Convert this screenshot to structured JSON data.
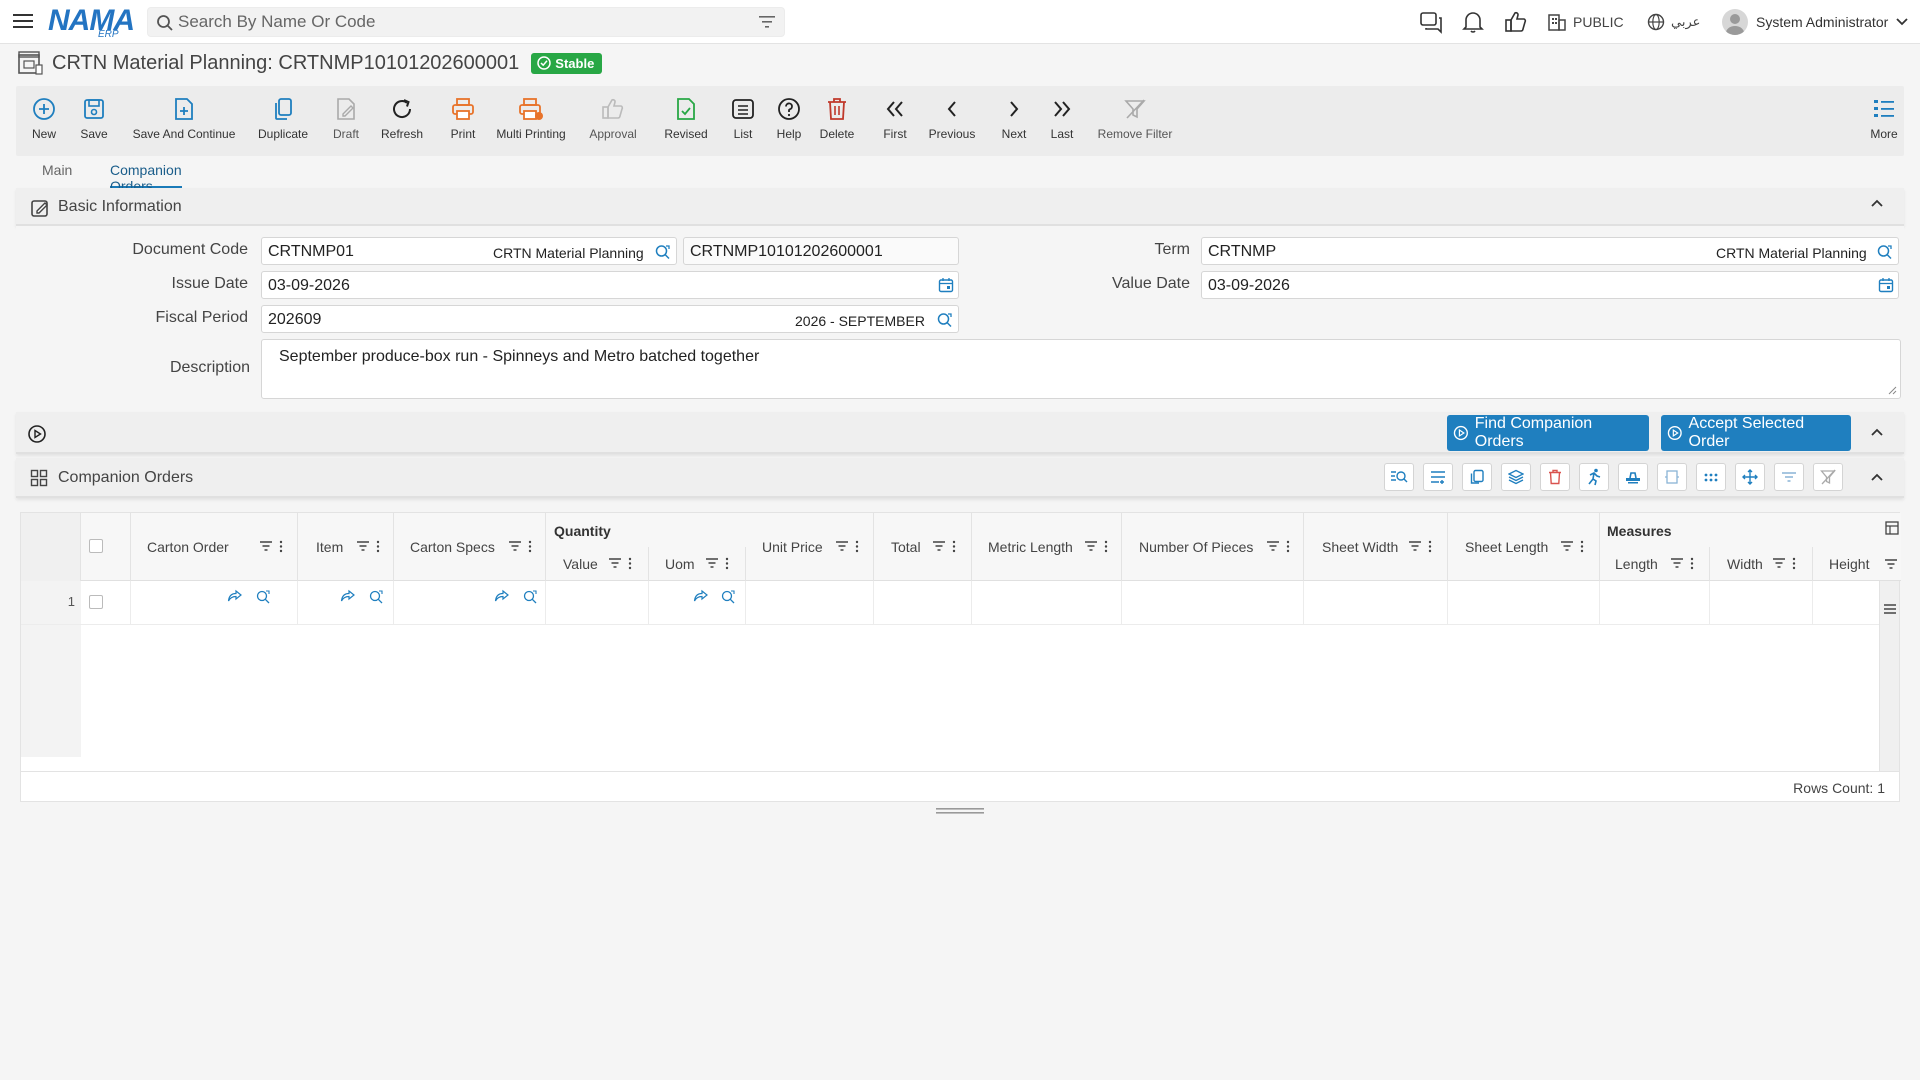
{
  "topbar": {
    "logo_main": "NAMA",
    "logo_sub": "ERP",
    "search_placeholder": "Search By Name Or Code",
    "public_label": "PUBLIC",
    "lang_label": "عربي",
    "user_name": "System Administrator"
  },
  "header": {
    "title": "CRTN Material Planning: CRTNMP10101202600001",
    "status": "Stable"
  },
  "toolbar": {
    "new": "New",
    "save": "Save",
    "save_continue": "Save And Continue",
    "duplicate": "Duplicate",
    "draft": "Draft",
    "refresh": "Refresh",
    "print": "Print",
    "multi_printing": "Multi Printing",
    "approval": "Approval",
    "revised": "Revised",
    "list": "List",
    "help": "Help",
    "delete": "Delete",
    "first": "First",
    "previous": "Previous",
    "next": "Next",
    "last": "Last",
    "remove_filter": "Remove Filter",
    "more": "More"
  },
  "tabs": {
    "main": "Main",
    "companion": "Companion Orders"
  },
  "basic": {
    "title": "Basic Information",
    "document_code_label": "Document Code",
    "document_code": "CRTNMP01",
    "document_code_tag": "CRTN Material Planning",
    "document_number": "CRTNMP10101202600001",
    "term_label": "Term",
    "term": "CRTNMP",
    "term_tag": "CRTN Material Planning",
    "issue_date_label": "Issue Date",
    "issue_date": "03-09-2026",
    "value_date_label": "Value Date",
    "value_date": "03-09-2026",
    "fiscal_label": "Fiscal Period",
    "fiscal": "202609",
    "fiscal_tag": "2026 - SEPTEMBER",
    "description_label": "Description",
    "description": "September produce-box run - Spinneys and Metro batched together"
  },
  "actions": {
    "find": "Find Companion Orders",
    "accept": "Accept Selected Order"
  },
  "companion": {
    "title": "Companion Orders",
    "columns": {
      "carton_order": "Carton Order",
      "item": "Item",
      "carton_specs": "Carton Specs",
      "quantity": "Quantity",
      "value": "Value",
      "uom": "Uom",
      "unit_price": "Unit Price",
      "total": "Total",
      "metric_length": "Metric Length",
      "number_of_pieces": "Number Of Pieces",
      "sheet_width": "Sheet Width",
      "sheet_length": "Sheet Length",
      "measures": "Measures",
      "length": "Length",
      "width": "Width",
      "height": "Height"
    },
    "rows": [
      {
        "index": "1"
      }
    ],
    "rows_count": "Rows Count: 1"
  },
  "colors": {
    "accent": "#1f7fbf",
    "status_green": "#28a745",
    "delete_red": "#c0392b",
    "print_orange": "#e8732a"
  }
}
